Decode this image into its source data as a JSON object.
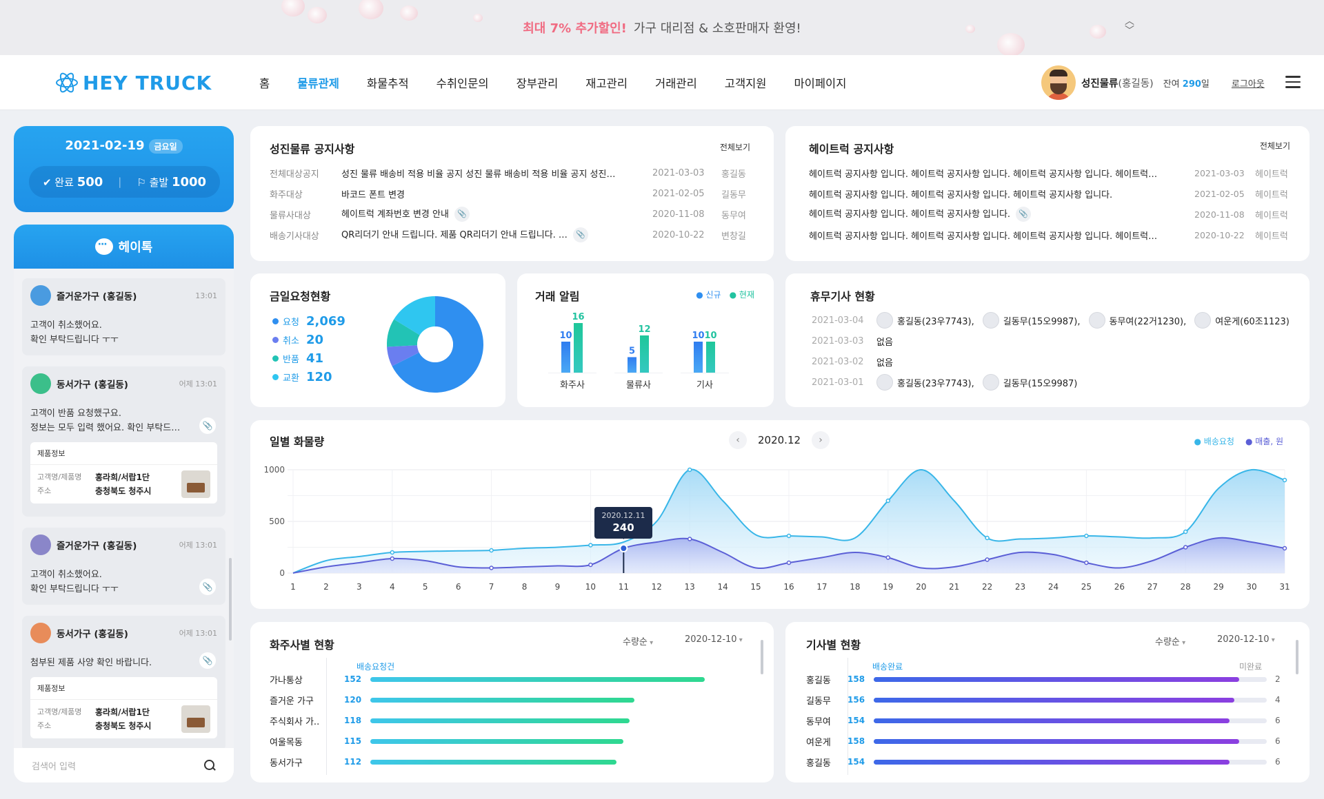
{
  "banner": {
    "highlight": "최대 7% 추가할인!",
    "text": "가구 대리점 & 소호판매자 환영!"
  },
  "header": {
    "logo": "HEY TRUCK",
    "nav": [
      "홈",
      "물류관제",
      "화물추적",
      "수취인문의",
      "장부관리",
      "재고관리",
      "거래관리",
      "고객지원",
      "마이페이지"
    ],
    "active_nav": "물류관제",
    "user": {
      "company": "성진물류",
      "name": "(홍길동)",
      "balance_prefix": "잔여",
      "balance_value": "290",
      "balance_unit": "일",
      "logout": "로그아웃"
    }
  },
  "date_card": {
    "date": "2021-02-19",
    "day": "금요일",
    "done_label": "완료",
    "done_value": "500",
    "depart_label": "출발",
    "depart_value": "1000"
  },
  "heytalk": {
    "title": "헤이톡",
    "messages": [
      {
        "name": "즐거운가구 (홍길동)",
        "time": "13:01",
        "lines": [
          "고객이 취소했어요.",
          "확인 부탁드립니다 ㅜㅜ"
        ],
        "avatar_color": "#4a9be0"
      },
      {
        "name": "동서가구 (홍길동)",
        "time": "어제 13:01",
        "lines": [
          "고객이 반품 요청했구요.",
          "정보는 모두 입력 했어요. 확인 부탁드…"
        ],
        "avatar_color": "#3bbf8a",
        "product": {
          "label": "제품정보",
          "k1": "고객명/제품명",
          "v1": "홍라희/서랍1단",
          "k2": "주소",
          "v2": "충청북도 청주시"
        }
      },
      {
        "name": "즐거운가구 (홍길동)",
        "time": "어제 13:01",
        "lines": [
          "고객이 취소했어요.",
          "확인 부탁드립니다 ㅜㅜ"
        ],
        "avatar_color": "#8a86c9"
      },
      {
        "name": "동서가구 (홍길동)",
        "time": "어제 13:01",
        "lines": [
          "첨부된 제품 사양 확인 바랍니다."
        ],
        "avatar_color": "#e88c5a",
        "product": {
          "label": "제품정보",
          "k1": "고객명/제품명",
          "v1": "홍라희/서랍1단",
          "k2": "주소",
          "v2": "충청북도 청주시"
        }
      }
    ],
    "search_placeholder": "검색어 입력"
  },
  "notice_sj": {
    "title": "성진물류 공지사항",
    "view_all": "전체보기",
    "rows": [
      {
        "cat": "전체대상공지",
        "title": "성진 물류 배송비 적용 비율 공지 성진 물류 배송비 적용 비율 공지 성진…",
        "date": "2021-03-03",
        "who": "홍길동",
        "clip": false
      },
      {
        "cat": "화주대상",
        "title": "바코드 폰트 변경",
        "date": "2021-02-05",
        "who": "길동무",
        "clip": false
      },
      {
        "cat": "물류사대상",
        "title": "헤이트럭 계좌번호 변경 안내",
        "date": "2020-11-08",
        "who": "동무여",
        "clip": true
      },
      {
        "cat": "배송기사대상",
        "title": "QR리더기 안내 드립니다. 제품 QR리더기 안내 드립니다. …",
        "date": "2020-10-22",
        "who": "변창길",
        "clip": true
      }
    ]
  },
  "notice_ht": {
    "title": "헤이트럭 공지사항",
    "view_all": "전체보기",
    "rows": [
      {
        "title": "헤이트럭 공지사항 입니다. 헤이트럭 공지사항 입니다. 헤이트럭 공지사항 입니다. 헤이트럭…",
        "date": "2021-03-03",
        "who": "헤이트럭",
        "clip": false
      },
      {
        "title": "헤이트럭 공지사항 입니다. 헤이트럭 공지사항 입니다. 헤이트럭 공지사항 입니다.",
        "date": "2021-02-05",
        "who": "헤이트럭",
        "clip": false
      },
      {
        "title": "헤이트럭 공지사항 입니다. 헤이트럭 공지사항 입니다.",
        "date": "2020-11-08",
        "who": "헤이트럭",
        "clip": true
      },
      {
        "title": "헤이트럭 공지사항 입니다. 헤이트럭 공지사항 입니다. 헤이트럭 공지사항 입니다. 헤이트럭…",
        "date": "2020-10-22",
        "who": "헤이트럭",
        "clip": false
      }
    ]
  },
  "today_requests": {
    "title": "금일요청현황",
    "items": [
      {
        "label": "요청",
        "value": "2,069",
        "num": 2069,
        "color": "#2f8ff0"
      },
      {
        "label": "취소",
        "value": "20",
        "num": 20,
        "color": "#6a7ef0"
      },
      {
        "label": "반품",
        "value": "41",
        "num": 41,
        "color": "#22c3b5"
      },
      {
        "label": "교환",
        "value": "120",
        "num": 120,
        "color": "#2fc6f0"
      }
    ]
  },
  "trade_alert": {
    "title": "거래 알림",
    "legend": [
      {
        "label": "신규",
        "color": "#2f8ff0"
      },
      {
        "label": "현재",
        "color": "#22c3a0"
      }
    ],
    "chart_data": {
      "type": "bar",
      "categories": [
        "화주사",
        "물류사",
        "기사"
      ],
      "series": [
        {
          "name": "신규",
          "values": [
            10,
            5,
            10
          ]
        },
        {
          "name": "현재",
          "values": [
            16,
            12,
            10
          ]
        }
      ]
    }
  },
  "drivers_off": {
    "title": "휴무기사 현황",
    "rows": [
      {
        "date": "2021-03-04",
        "people": [
          "홍길동(23우7743),",
          "길동무(15오9987),",
          "동무여(22거1230),",
          "여운게(60조1123)"
        ]
      },
      {
        "date": "2021-03-03",
        "people": [],
        "none": "없음"
      },
      {
        "date": "2021-03-02",
        "people": [],
        "none": "없음"
      },
      {
        "date": "2021-03-01",
        "people": [
          "홍길동(23우7743),",
          "길동무(15오9987)"
        ]
      }
    ]
  },
  "daily_cargo": {
    "title": "일별 화물량",
    "month": "2020.12",
    "legend": [
      {
        "label": "배송요청",
        "color": "#38b6e8"
      },
      {
        "label": "매출, 원",
        "color": "#5b5fd6"
      }
    ],
    "tooltip": {
      "date": "2020.12.11",
      "value": "240"
    },
    "chart_data": {
      "type": "area",
      "x": [
        1,
        2,
        3,
        4,
        5,
        6,
        7,
        8,
        9,
        10,
        11,
        12,
        13,
        14,
        15,
        16,
        17,
        18,
        19,
        20,
        21,
        22,
        23,
        24,
        25,
        26,
        27,
        28,
        29,
        30,
        31
      ],
      "ylim": [
        0,
        1000
      ],
      "yticks": [
        0,
        500,
        1000
      ],
      "series": [
        {
          "name": "배송요청",
          "values": [
            0,
            120,
            160,
            200,
            210,
            215,
            220,
            240,
            250,
            270,
            300,
            500,
            1000,
            700,
            370,
            360,
            350,
            340,
            700,
            1000,
            700,
            340,
            330,
            340,
            360,
            350,
            340,
            400,
            820,
            1000,
            900
          ]
        },
        {
          "name": "매출, 원",
          "values": [
            0,
            60,
            100,
            140,
            120,
            60,
            50,
            60,
            70,
            80,
            240,
            300,
            330,
            200,
            50,
            100,
            150,
            200,
            150,
            50,
            60,
            130,
            200,
            180,
            100,
            50,
            120,
            250,
            340,
            300,
            240
          ]
        }
      ]
    }
  },
  "shipper_status": {
    "title": "화주사별 현황",
    "sort": "수량순",
    "date": "2020-12-10",
    "col_label": "배송요청건",
    "chart_data": {
      "type": "bar",
      "categories": [
        "가나통상",
        "즐거운 가구",
        "주식회사 가..",
        "여울목동",
        "동서가구"
      ],
      "values": [
        152,
        120,
        118,
        115,
        112
      ],
      "value_labels": [
        "152",
        "120",
        "118",
        "115",
        "112"
      ],
      "xlim": [
        0,
        180
      ]
    }
  },
  "driver_status": {
    "title": "기사별 현황",
    "sort": "수량순",
    "date": "2020-12-10",
    "col_label": "배송완료",
    "col_right": "미완료",
    "chart_data": {
      "type": "bar",
      "categories": [
        "홍길동",
        "길동무",
        "동무여",
        "여운게",
        "홍길동"
      ],
      "values": [
        158,
        156,
        154,
        158,
        154
      ],
      "value_labels": [
        "158",
        "156",
        "154",
        "158",
        "154"
      ],
      "incomplete": [
        "2",
        "4",
        "6",
        "6",
        "6"
      ],
      "xlim": [
        0,
        170
      ]
    }
  }
}
